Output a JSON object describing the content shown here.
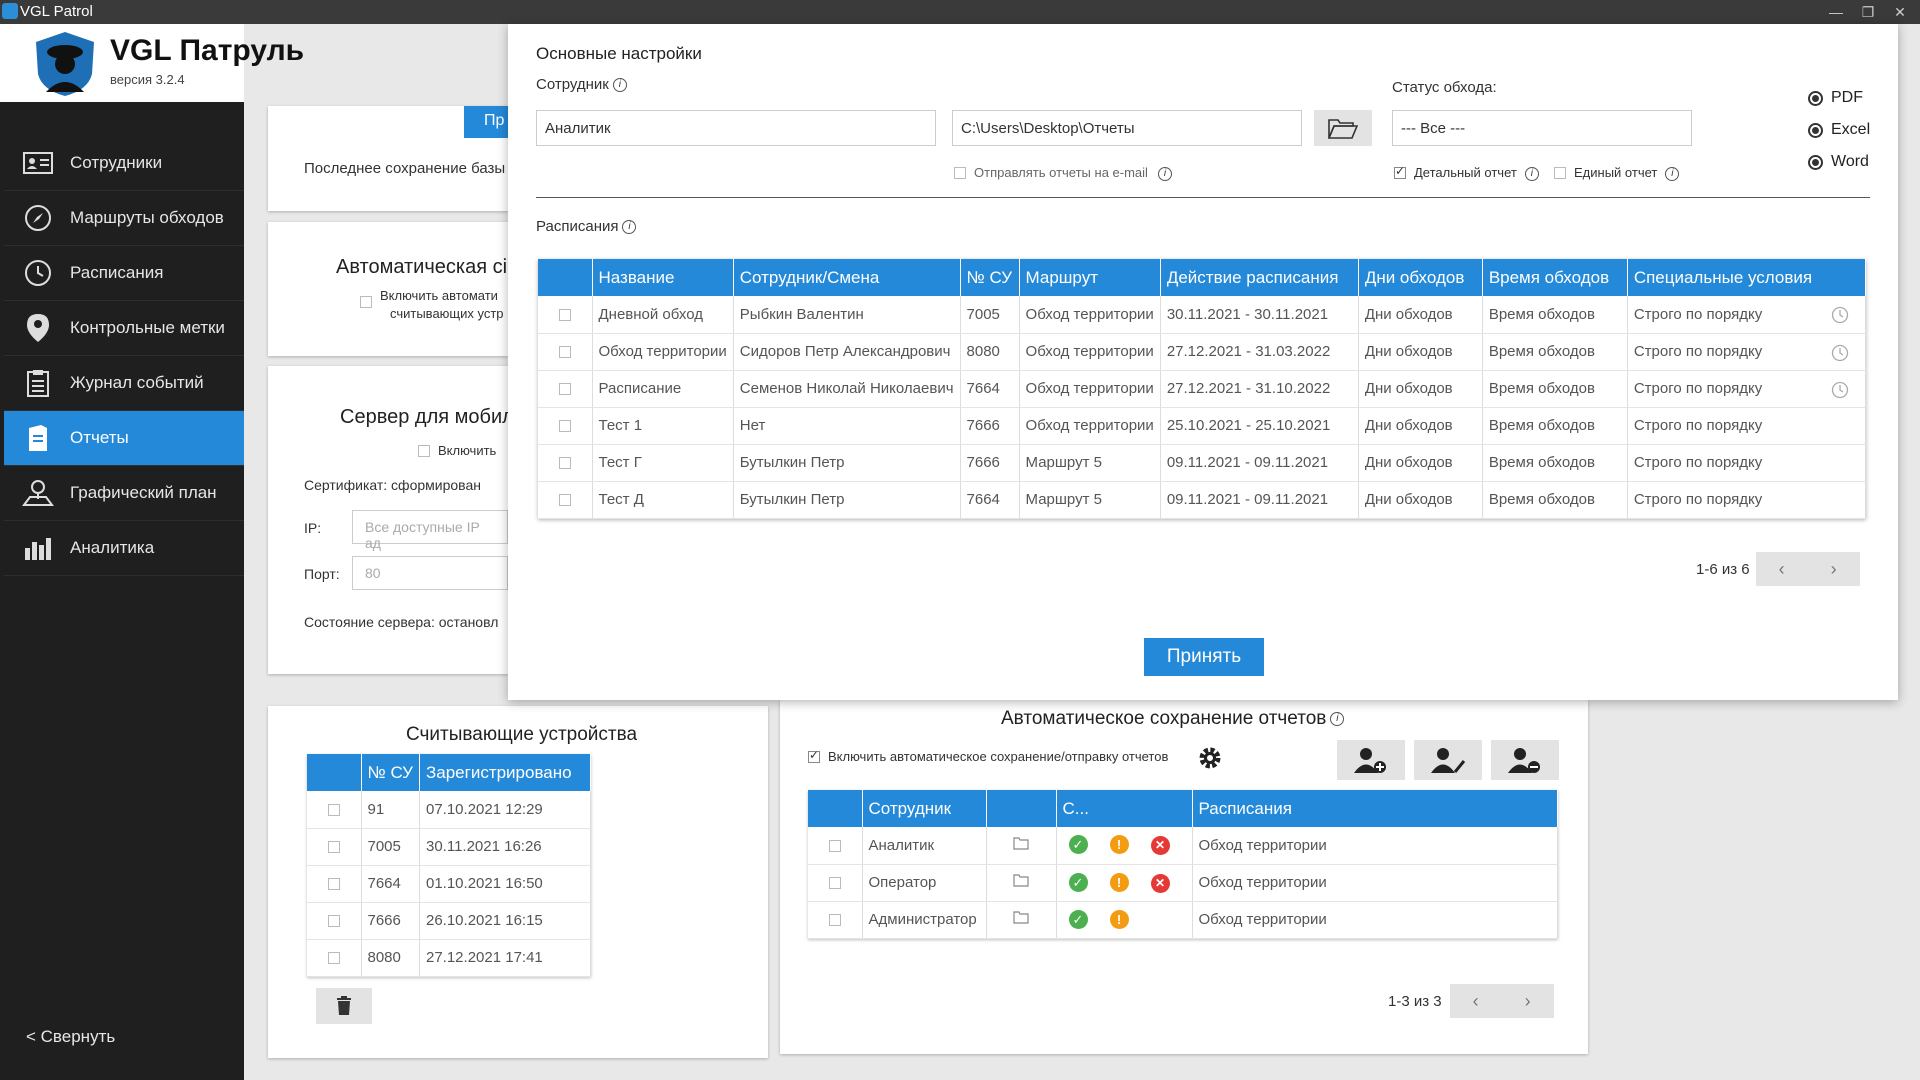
{
  "window": {
    "title": "VGL Patrol"
  },
  "app": {
    "name": "VGL Патруль",
    "version": "версия 3.2.4"
  },
  "sidebar": {
    "items": [
      {
        "label": "Сотрудники",
        "icon": "employee-card-icon"
      },
      {
        "label": "Маршруты обходов",
        "icon": "compass-icon"
      },
      {
        "label": "Расписания",
        "icon": "clock-icon"
      },
      {
        "label": "Контрольные метки",
        "icon": "map-pin-icon"
      },
      {
        "label": "Журнал событий",
        "icon": "clipboard-icon"
      },
      {
        "label": "Отчеты",
        "icon": "reports-icon",
        "active": true
      },
      {
        "label": "Графический план",
        "icon": "map-person-icon"
      },
      {
        "label": "Аналитика",
        "icon": "bar-chart-icon"
      }
    ],
    "collapse_label": "< Свернуть"
  },
  "background": {
    "btn_partial": "Пр",
    "last_save": "Последнее сохранение базы ,",
    "auto_title": "Автоматическая сі",
    "auto_cb_line1": "Включить автомати",
    "auto_cb_line2": "считывающих устр",
    "server_title": "Сервер для мобил",
    "server_enable": "Включить",
    "certificate": "Сертификат: сформирован",
    "ip_label": "IP:",
    "ip_placeholder": "Все доступные IP ад",
    "port_label": "Порт:",
    "port_value": "80",
    "server_state": "Состояние сервера: остановл"
  },
  "readers": {
    "title": "Считывающие устройства",
    "columns": [
      "№ СУ",
      "Зарегистрировано"
    ],
    "rows": [
      {
        "id": "91",
        "date": "07.10.2021 12:29"
      },
      {
        "id": "7005",
        "date": "30.11.2021 16:26"
      },
      {
        "id": "7664",
        "date": "01.10.2021 16:50"
      },
      {
        "id": "7666",
        "date": "26.10.2021 16:15"
      },
      {
        "id": "8080",
        "date": "27.12.2021 17:41"
      }
    ]
  },
  "autosave": {
    "title": "Автоматическое сохранение отчетов",
    "enable_label": "Включить автоматическое сохранение/отправку отчетов",
    "columns": [
      "Сотрудник",
      "С...",
      "Расписания"
    ],
    "rows": [
      {
        "employee": "Аналитик",
        "statuses": [
          "ok",
          "warn",
          "err"
        ],
        "schedule": "Обход территории"
      },
      {
        "employee": "Оператор",
        "statuses": [
          "ok",
          "warn",
          "err"
        ],
        "schedule": "Обход территории"
      },
      {
        "employee": "Администратор",
        "statuses": [
          "ok",
          "warn"
        ],
        "schedule": "Обход территории"
      }
    ],
    "pager_text": "1-3 из 3"
  },
  "modal": {
    "heading": "Основные настройки",
    "employee_label": "Сотрудник",
    "employee_value": "Аналитик",
    "path_value": "C:\\Users\\Desktop\\Отчеты",
    "send_email_label": "Отправлять отчеты на e-mail",
    "status_label": "Статус обхода:",
    "status_value": "--- Все ---",
    "detailed_label": "Детальный отчет",
    "single_label": "Единый отчет",
    "formats": [
      "PDF",
      "Excel",
      "Word"
    ],
    "schedules_label": "Расписания",
    "columns": [
      "Название",
      "Сотрудник/Смена",
      "№ СУ",
      "Маршрут",
      "Действие расписания",
      "Дни обходов",
      "Время обходов",
      "Специальные условия"
    ],
    "rows": [
      {
        "name": "Дневной обход",
        "employee": "Рыбкин Валентин",
        "su": "7005",
        "route": "Обход территории",
        "period": "30.11.2021 - 30.11.2021",
        "days": "Дни обходов",
        "time": "Время обходов",
        "cond": "Строго по порядку",
        "clock": true
      },
      {
        "name": "Обход территории",
        "employee": "Сидоров Петр Александрович",
        "su": "8080",
        "route": "Обход территории",
        "period": "27.12.2021 - 31.03.2022",
        "days": "Дни обходов",
        "time": "Время обходов",
        "cond": "Строго по порядку",
        "clock": true
      },
      {
        "name": "Расписание",
        "employee": "Семенов Николай Николаевич",
        "su": "7664",
        "route": "Обход территории",
        "period": "27.12.2021 - 31.10.2022",
        "days": "Дни обходов",
        "time": "Время обходов",
        "cond": "Строго по порядку",
        "clock": true
      },
      {
        "name": "Тест 1",
        "employee": "Нет",
        "su": "7666",
        "route": "Обход территории",
        "period": "25.10.2021 - 25.10.2021",
        "days": "Дни обходов",
        "time": "Время обходов",
        "cond": "Строго по порядку",
        "clock": false
      },
      {
        "name": "Тест Г",
        "employee": "Бутылкин Петр",
        "su": "7666",
        "route": "Маршрут 5",
        "period": "09.11.2021 - 09.11.2021",
        "days": "Дни обходов",
        "time": "Время обходов",
        "cond": "Строго по порядку",
        "clock": false
      },
      {
        "name": "Тест Д",
        "employee": "Бутылкин Петр",
        "su": "7664",
        "route": "Маршрут 5",
        "period": "09.11.2021 - 09.11.2021",
        "days": "Дни обходов",
        "time": "Время обходов",
        "cond": "Строго по порядку",
        "clock": false
      }
    ],
    "pager_text": "1-6 из 6",
    "accept_label": "Принять"
  },
  "colors": {
    "accent": "#2389d8",
    "sidebar_bg": "#1f1f1f",
    "ok": "#4caf50",
    "warn": "#f39c12",
    "error": "#e53935"
  }
}
